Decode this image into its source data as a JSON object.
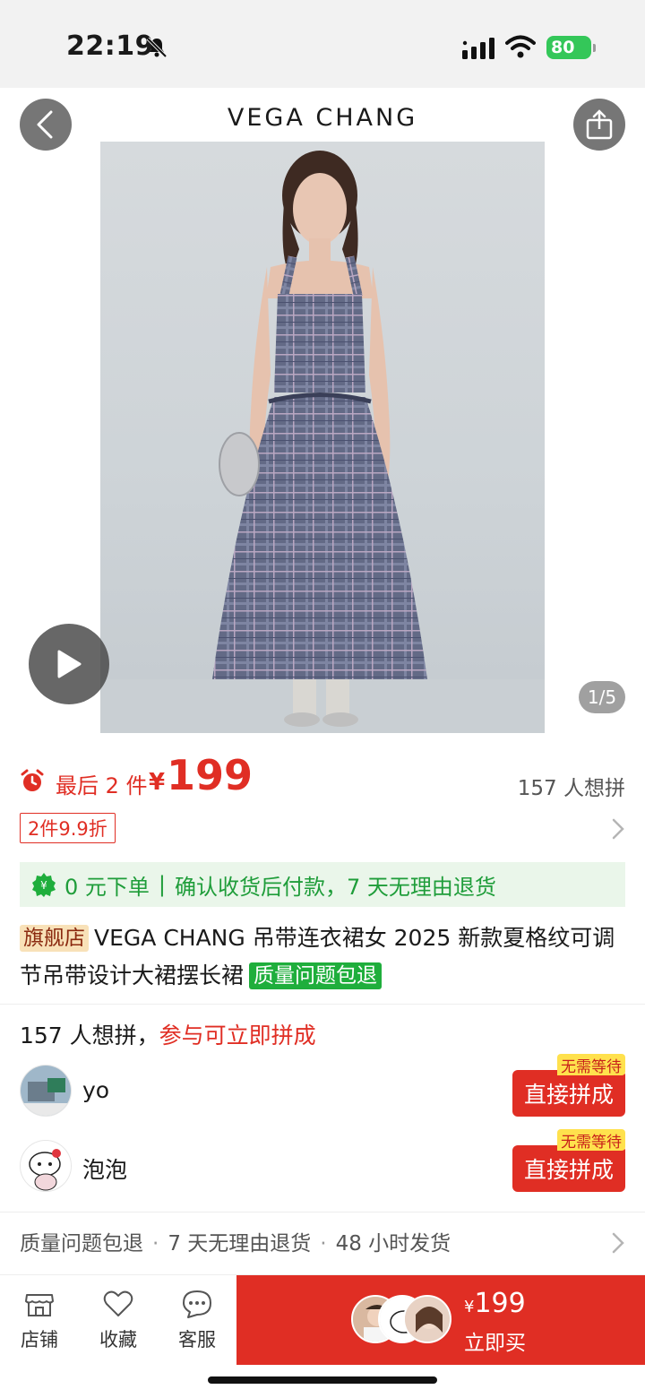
{
  "status_bar": {
    "time": "22:19",
    "battery": "80"
  },
  "header": {
    "brand": "VEGA CHANG"
  },
  "gallery": {
    "counter": "1/5"
  },
  "price": {
    "stock_text": "最后 2 件",
    "currency": "¥",
    "amount": "199",
    "want_count": "157 人想拼"
  },
  "promotion": {
    "discount_tag": "2件9.9折"
  },
  "guarantee": {
    "free_order": "0 元下单",
    "separator": "|",
    "detail": "确认收货后付款，7 天无理由退货"
  },
  "product": {
    "store_tag": "旗舰店",
    "title": "VEGA CHANG 吊带连衣裙女 2025 新款夏格纹可调节吊带设计大裙摆长裙",
    "quality_tag": "质量问题包退"
  },
  "group_buy": {
    "count_text": "157 人想拼，",
    "cta_text": "参与可立即拼成",
    "participants": [
      {
        "name": "yo",
        "badge": "无需等待",
        "button": "直接拼成"
      },
      {
        "name": "泡泡",
        "badge": "无需等待",
        "button": "直接拼成"
      }
    ]
  },
  "services": {
    "items": [
      "质量问题包退",
      "7 天无理由退货",
      "48 小时发货"
    ],
    "separator": "·"
  },
  "bottom_bar": {
    "tabs": [
      {
        "label": "店铺",
        "icon": "store-icon"
      },
      {
        "label": "收藏",
        "icon": "heart-icon"
      },
      {
        "label": "客服",
        "icon": "chat-icon"
      }
    ],
    "buy": {
      "currency": "¥",
      "price": "199",
      "label": "立即买"
    }
  },
  "colors": {
    "accent": "#e02e24",
    "green": "#1fae3c",
    "badge_yellow": "#ffe14d"
  }
}
